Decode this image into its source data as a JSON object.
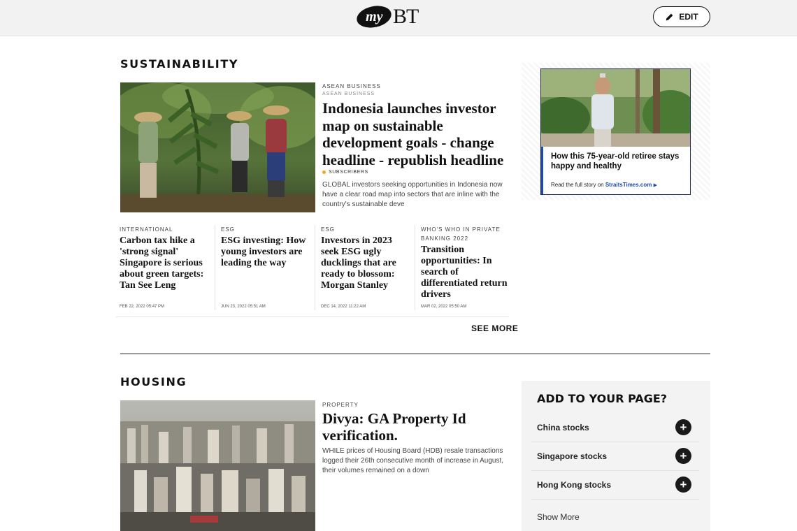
{
  "header": {
    "logo_my": "my",
    "logo_bt": "BT",
    "edit_label": "EDIT"
  },
  "sustainability": {
    "title": "SUSTAINABILITY",
    "featured": {
      "kicker": "ASEAN BUSINESS",
      "kicker_sub": "ASEAN BUSINESS",
      "headline": "Indonesia launches investor map on sustainable development goals - change headline - republish headline",
      "badge": "SUBSCRIBERS",
      "snippet": "GLOBAL investors seeking opportunities in Indonesia now have a clear road map into sectors that are inline with the country's sustainable deve"
    },
    "stories": [
      {
        "kicker": "INTERNATIONAL",
        "headline": "Carbon tax hike a 'strong signal' Singapore is serious about green targets: Tan See Leng",
        "date": "FEB 22, 2022 05:47 PM"
      },
      {
        "kicker": "ESG",
        "headline": "ESG investing: How young investors are leading the way",
        "date": "JUN 23, 2022 05:51 AM"
      },
      {
        "kicker": "ESG",
        "headline": "Investors in 2023 seek ESG ugly ducklings that are ready to blossom: Morgan Stanley",
        "date": "DEC 14, 2022 11:22 AM"
      },
      {
        "kicker": "WHO'S WHO IN PRIVATE BANKING 2022",
        "headline": "Transition opportunities: In search of differentiated return drivers",
        "date": "MAR 02, 2022 05:50 AM"
      }
    ],
    "see_more": "SEE MORE"
  },
  "ad": {
    "title": "How this 75-year-old retiree stays happy and healthy",
    "cta_prefix": "Read the full story on ",
    "cta_link": "StraitsTimes.com",
    "cta_arrow": "▶"
  },
  "housing": {
    "title": "HOUSING",
    "featured": {
      "kicker": "PROPERTY",
      "headline": "Divya: GA Property Id verification.",
      "snippet": "WHILE prices of Housing Board (HDB) resale transactions logged their 26th consecutive month of increase in August, their volumes remained on a down"
    }
  },
  "add_to_page": {
    "title": "ADD TO YOUR PAGE?",
    "items": [
      {
        "label": "China stocks"
      },
      {
        "label": "Singapore stocks"
      },
      {
        "label": "Hong Kong stocks"
      }
    ],
    "show_more": "Show More",
    "plus_symbol": "+"
  },
  "colors": {
    "header_bg": "#f2f2f2",
    "subscriber_dot": "#f2a81d",
    "ad_accent": "#1c4aa8",
    "panel_bg": "#f3f3f3"
  }
}
